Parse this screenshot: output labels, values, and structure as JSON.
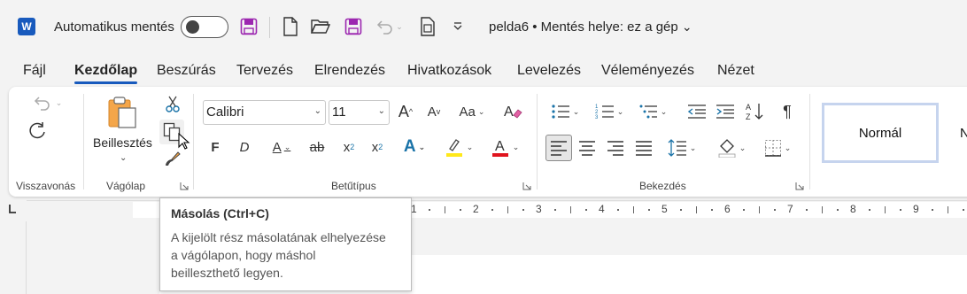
{
  "titlebar": {
    "app_logo": "W",
    "autosave_label": "Automatikus mentés",
    "document_title": "pelda6 • Mentés helye: ez a gép",
    "title_chevron": "⌄",
    "accent": "#185abd",
    "save_icon_color": "#9c27b0"
  },
  "tabs": [
    "Fájl",
    "Kezdőlap",
    "Beszúrás",
    "Tervezés",
    "Elrendezés",
    "Hivatkozások",
    "Levelezés",
    "Véleményezés",
    "Nézet"
  ],
  "ribbon": {
    "groups": {
      "undo": "Visszavonás",
      "clipboard": "Vágólap",
      "font": "Betűtípus",
      "paragraph": "Bekezdés"
    },
    "paste_label": "Beillesztés",
    "font_name": "Calibri",
    "font_size": "11",
    "styles": [
      "Normál",
      "N"
    ]
  },
  "ruler_numbers": [
    "1",
    "2",
    "3",
    "4",
    "5",
    "6",
    "7",
    "8",
    "9"
  ],
  "tooltip": {
    "title": "Másolás (Ctrl+C)",
    "line1": "A kijelölt rész másolatának elhelyezése",
    "line2": "a vágólapon, hogy máshol",
    "line3": "beilleszthető legyen."
  }
}
